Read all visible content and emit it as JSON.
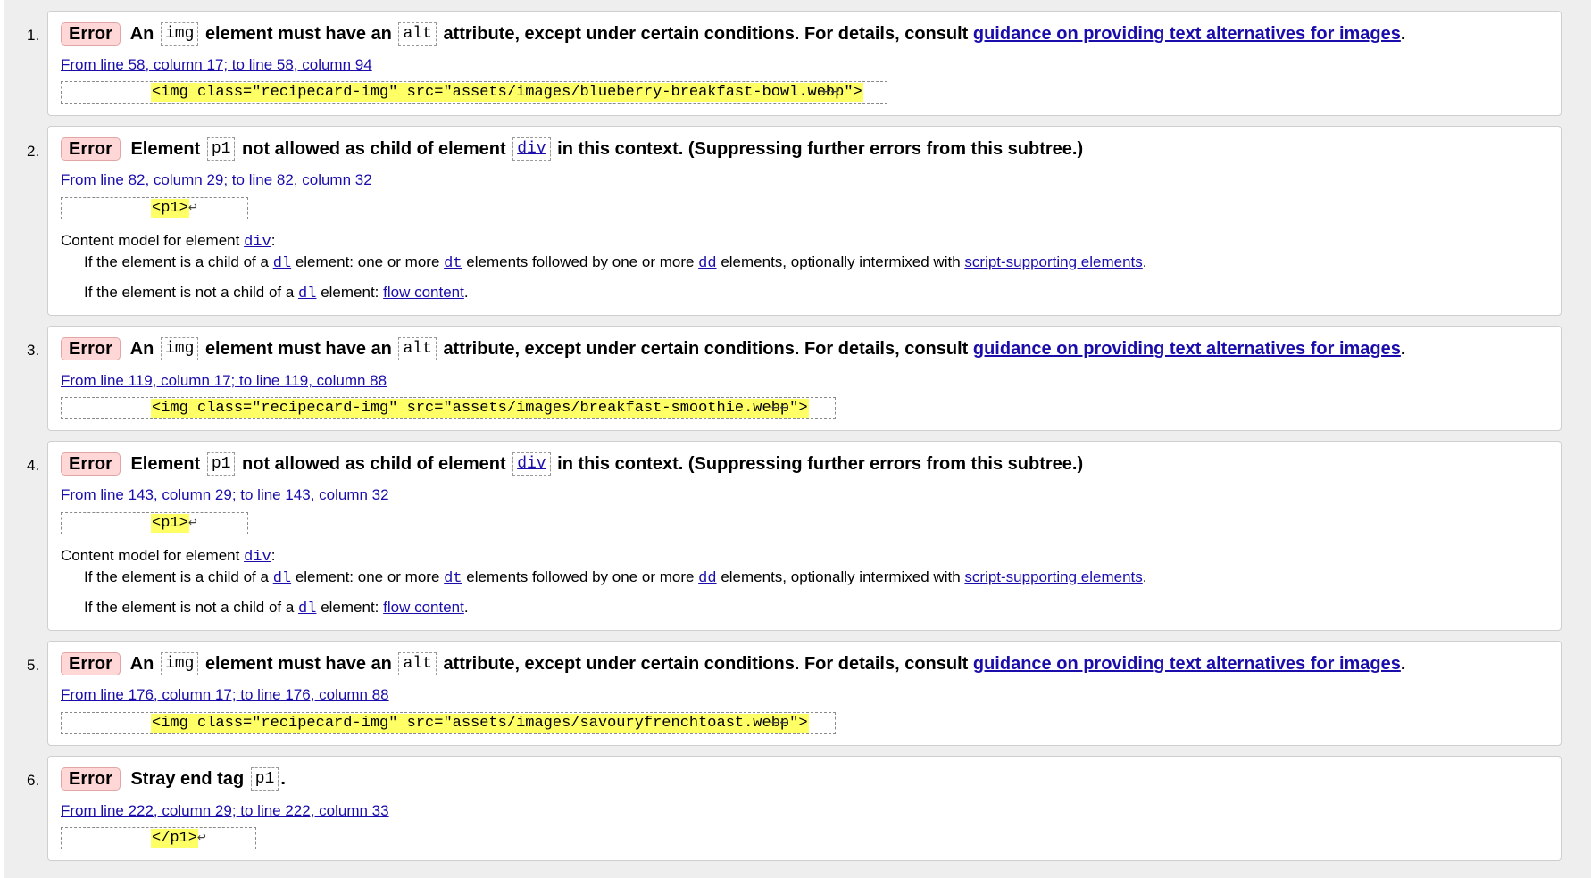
{
  "errors": [
    {
      "number": "1.",
      "badge": "Error",
      "msg_before": "An",
      "code1": "img",
      "msg_mid": "element must have an",
      "code2": "alt",
      "msg_after": "attribute, except under certain conditions. For details, consult",
      "msg_link": "guidance on providing text alternatives for images",
      "msg_end": ".",
      "location": "From line 58, column 17; to line 58, column 94",
      "extract": "<img class=\"recipecard-img\" src=\"assets/images/blueberry-breakfast-bowl.webp\">",
      "extract_tail": "↩↩"
    },
    {
      "number": "2.",
      "badge": "Error",
      "msg_before": "Element",
      "code1": "p1",
      "msg_mid": "not allowed as child of element",
      "code2": "div",
      "msg_after": "in this context. (Suppressing further errors from this subtree.)",
      "location": "From line 82, column 29; to line 82, column 32",
      "extract": "<p1>",
      "extract_tail": "↩",
      "content_model_label": "Content model for element",
      "content_model_el": "div",
      "cm1_a": "If the element is a child of a",
      "cm1_dl": "dl",
      "cm1_b": "element: one or more",
      "cm1_dt": "dt",
      "cm1_c": "elements followed by one or more",
      "cm1_dd": "dd",
      "cm1_d": "elements, optionally intermixed with",
      "cm1_link": "script-supporting elements",
      "cm2_a": "If the element is not a child of a",
      "cm2_dl": "dl",
      "cm2_b": "element:",
      "cm2_link": "flow content"
    },
    {
      "number": "3.",
      "badge": "Error",
      "msg_before": "An",
      "code1": "img",
      "msg_mid": "element must have an",
      "code2": "alt",
      "msg_after": "attribute, except under certain conditions. For details, consult",
      "msg_link": "guidance on providing text alternatives for images",
      "msg_end": ".",
      "location": "From line 119, column 17; to line 119, column 88",
      "extract": "<img class=\"recipecard-img\" src=\"assets/images/breakfast-smoothie.webp\">",
      "extract_tail": "↩↩"
    },
    {
      "number": "4.",
      "badge": "Error",
      "msg_before": "Element",
      "code1": "p1",
      "msg_mid": "not allowed as child of element",
      "code2": "div",
      "msg_after": "in this context. (Suppressing further errors from this subtree.)",
      "location": "From line 143, column 29; to line 143, column 32",
      "extract": "<p1>",
      "extract_tail": "↩",
      "content_model_label": "Content model for element",
      "content_model_el": "div",
      "cm1_a": "If the element is a child of a",
      "cm1_dl": "dl",
      "cm1_b": "element: one or more",
      "cm1_dt": "dt",
      "cm1_c": "elements followed by one or more",
      "cm1_dd": "dd",
      "cm1_d": "elements, optionally intermixed with",
      "cm1_link": "script-supporting elements",
      "cm2_a": "If the element is not a child of a",
      "cm2_dl": "dl",
      "cm2_b": "element:",
      "cm2_link": "flow content"
    },
    {
      "number": "5.",
      "badge": "Error",
      "msg_before": "An",
      "code1": "img",
      "msg_mid": "element must have an",
      "code2": "alt",
      "msg_after": "attribute, except under certain conditions. For details, consult",
      "msg_link": "guidance on providing text alternatives for images",
      "msg_end": ".",
      "location": "From line 176, column 17; to line 176, column 88",
      "extract": "<img class=\"recipecard-img\" src=\"assets/images/savouryfrenchtoast.webp\">",
      "extract_tail": "↩↩"
    },
    {
      "number": "6.",
      "badge": "Error",
      "msg_before": "Stray end tag",
      "code1": "p1",
      "msg_end": ".",
      "location": "From line 222, column 29; to line 222, column 33",
      "extract": "</p1>",
      "extract_tail": "↩"
    }
  ]
}
